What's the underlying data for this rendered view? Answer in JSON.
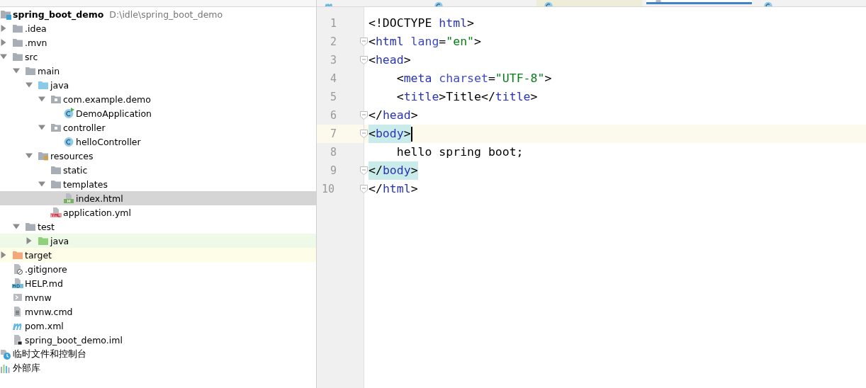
{
  "project_tree": {
    "root": {
      "name": "spring_boot_demo",
      "path": "D:\\idle\\spring_boot_demo",
      "kind": "module"
    },
    "children": [
      {
        "name": ".idea",
        "kind": "folder",
        "expanded": false,
        "selected": false
      },
      {
        "name": ".mvn",
        "kind": "folder",
        "expanded": false,
        "selected": false
      },
      {
        "name": "src",
        "kind": "folder",
        "expanded": true,
        "selected": false,
        "children": [
          {
            "name": "main",
            "kind": "folder",
            "expanded": true,
            "selected": false,
            "children": [
              {
                "name": "java",
                "kind": "source",
                "expanded": true,
                "selected": false,
                "children": [
                  {
                    "name": "com.example.demo",
                    "kind": "package",
                    "expanded": true,
                    "selected": false,
                    "children": [
                      {
                        "name": "DemoApplication",
                        "kind": "runclass",
                        "selected": false
                      }
                    ]
                  },
                  {
                    "name": "controller",
                    "kind": "package",
                    "expanded": true,
                    "selected": false,
                    "children": [
                      {
                        "name": "helloController",
                        "kind": "class",
                        "selected": false
                      }
                    ]
                  }
                ]
              },
              {
                "name": "resources",
                "kind": "resources",
                "expanded": true,
                "selected": false,
                "children": [
                  {
                    "name": "static",
                    "kind": "folder",
                    "selected": false
                  },
                  {
                    "name": "templates",
                    "kind": "folder",
                    "expanded": true,
                    "selected": false,
                    "children": [
                      {
                        "name": "index.html",
                        "kind": "html",
                        "selected": true
                      }
                    ]
                  },
                  {
                    "name": "application.yml",
                    "kind": "yml",
                    "selected": false
                  }
                ]
              }
            ]
          },
          {
            "name": "test",
            "kind": "folder",
            "expanded": true,
            "selected": false,
            "children": [
              {
                "name": "java",
                "kind": "testsource",
                "expanded": false,
                "selected": false
              }
            ]
          }
        ]
      },
      {
        "name": "target",
        "kind": "excluded",
        "expanded": false,
        "selected": false
      },
      {
        "name": ".gitignore",
        "kind": "ignore",
        "selected": false
      },
      {
        "name": "HELP.md",
        "kind": "md",
        "selected": false
      },
      {
        "name": "mvnw",
        "kind": "shell",
        "selected": false
      },
      {
        "name": "mvnw.cmd",
        "kind": "text",
        "selected": false
      },
      {
        "name": "pom.xml",
        "kind": "maven",
        "selected": false
      },
      {
        "name": "spring_boot_demo.iml",
        "kind": "iml",
        "selected": false
      }
    ],
    "extra": [
      {
        "name": "临时文件和控制台",
        "kind": "scratch"
      },
      {
        "name": "外部库",
        "kind": "libraries"
      }
    ]
  },
  "editor_tabs": [
    {
      "selected": false,
      "kind": "maven"
    },
    {
      "selected": false,
      "kind": "class"
    },
    {
      "selected": false,
      "kind": "testclass"
    },
    {
      "selected": true,
      "kind": "html"
    },
    {
      "selected": false,
      "kind": "class"
    }
  ],
  "editor": {
    "lines": [
      {
        "number": "1",
        "fold": false,
        "current": false,
        "tokens": [
          {
            "text": "<!DOCTYPE ",
            "kind": "plain"
          },
          {
            "text": "html",
            "kind": "tag"
          },
          {
            "text": ">",
            "kind": "plain"
          }
        ]
      },
      {
        "number": "2",
        "fold": true,
        "current": false,
        "tokens": [
          {
            "text": "<",
            "kind": "plain"
          },
          {
            "text": "html ",
            "kind": "tag"
          },
          {
            "text": "lang",
            "kind": "attr"
          },
          {
            "text": "=",
            "kind": "plain"
          },
          {
            "text": "\"en\"",
            "kind": "value"
          },
          {
            "text": ">",
            "kind": "plain"
          }
        ]
      },
      {
        "number": "3",
        "fold": true,
        "current": false,
        "tokens": [
          {
            "text": "<",
            "kind": "plain"
          },
          {
            "text": "head",
            "kind": "tag"
          },
          {
            "text": ">",
            "kind": "plain"
          }
        ]
      },
      {
        "number": "4",
        "fold": false,
        "current": false,
        "tokens": [
          {
            "text": "    <",
            "kind": "plain"
          },
          {
            "text": "meta ",
            "kind": "tag"
          },
          {
            "text": "charset",
            "kind": "attr"
          },
          {
            "text": "=",
            "kind": "plain"
          },
          {
            "text": "\"UTF-8\"",
            "kind": "value"
          },
          {
            "text": ">",
            "kind": "plain"
          }
        ]
      },
      {
        "number": "5",
        "fold": false,
        "current": false,
        "tokens": [
          {
            "text": "    <",
            "kind": "plain"
          },
          {
            "text": "title",
            "kind": "tag"
          },
          {
            "text": ">Title</",
            "kind": "plain"
          },
          {
            "text": "title",
            "kind": "tag"
          },
          {
            "text": ">",
            "kind": "plain"
          }
        ]
      },
      {
        "number": "6",
        "fold": true,
        "current": false,
        "tokens": [
          {
            "text": "</",
            "kind": "plain"
          },
          {
            "text": "head",
            "kind": "tag"
          },
          {
            "text": ">",
            "kind": "plain"
          }
        ]
      },
      {
        "number": "7",
        "fold": true,
        "current": true,
        "caret": true,
        "tokens": [
          {
            "text": "<",
            "kind": "plain",
            "matched": true
          },
          {
            "text": "body",
            "kind": "tag",
            "matched": true
          },
          {
            "text": ">",
            "kind": "plain",
            "matched": true
          }
        ]
      },
      {
        "number": "8",
        "fold": false,
        "current": false,
        "tokens": [
          {
            "text": "    hello spring boot;",
            "kind": "plain"
          }
        ]
      },
      {
        "number": "9",
        "fold": true,
        "current": false,
        "tokens": [
          {
            "text": "</",
            "kind": "plain",
            "matched": true
          },
          {
            "text": "body",
            "kind": "tag",
            "matched": true
          },
          {
            "text": ">",
            "kind": "plain",
            "matched": true
          }
        ]
      },
      {
        "number": "10",
        "fold": true,
        "current": false,
        "tokens": [
          {
            "text": "</",
            "kind": "plain"
          },
          {
            "text": "html",
            "kind": "tag"
          },
          {
            "text": ">",
            "kind": "plain"
          }
        ]
      }
    ]
  }
}
